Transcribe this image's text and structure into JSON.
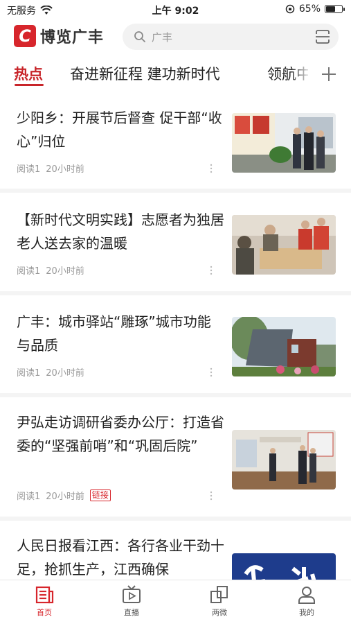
{
  "status_bar": {
    "carrier": "无服务",
    "time": "上午 9:02",
    "battery": "65%",
    "battery_level": 0.65
  },
  "header": {
    "logo_letter": "C",
    "app_name": "博览广丰",
    "search_placeholder": "广丰"
  },
  "tabs": [
    {
      "label": "热点",
      "active": true
    },
    {
      "label": "奋进新征程 建功新时代",
      "active": false
    },
    {
      "label": "领航中国",
      "active": false
    }
  ],
  "articles": [
    {
      "title": "少阳乡：开展节后督查 促干部“收心”归位",
      "reads": "阅读1",
      "time": "20小时前",
      "badge": ""
    },
    {
      "title": "【新时代文明实践】志愿者为独居老人送去家的温暖",
      "reads": "阅读1",
      "time": "20小时前",
      "badge": ""
    },
    {
      "title": "广丰：城市驿站“雕琢”城市功能与品质",
      "reads": "阅读1",
      "time": "20小时前",
      "badge": ""
    },
    {
      "title": "尹弘走访调研省委办公厅：打造省委的“坚强前哨”和“巩固后院”",
      "reads": "阅读1",
      "time": "20小时前",
      "badge": "链接"
    },
    {
      "title": "人民日报看江西：各行各业干劲十足，抢抓生产，江西确保",
      "reads": "",
      "time": "",
      "badge": ""
    }
  ],
  "tab_bar": [
    {
      "label": "首页",
      "icon": "home-news-icon",
      "active": true
    },
    {
      "label": "直播",
      "icon": "live-tv-icon",
      "active": false
    },
    {
      "label": "两微",
      "icon": "weibo-wechat-icon",
      "active": false
    },
    {
      "label": "我的",
      "icon": "profile-icon",
      "active": false
    }
  ],
  "colors": {
    "brand_red": "#d7262c",
    "tab_active": "#c8252a"
  }
}
